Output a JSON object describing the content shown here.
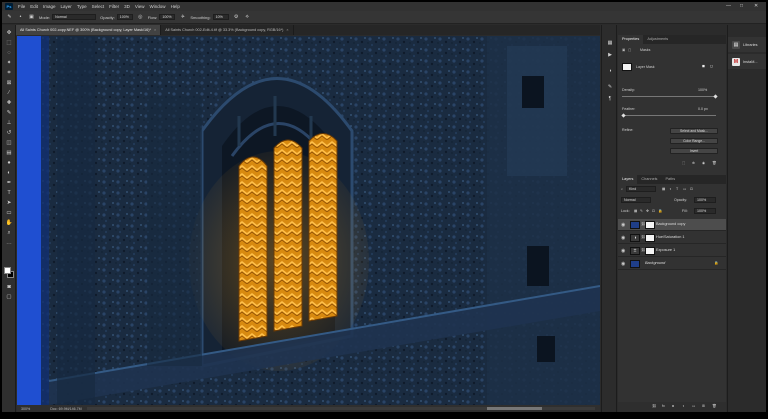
{
  "menu": {
    "logo": "Ps",
    "items": [
      "File",
      "Edit",
      "Image",
      "Layer",
      "Type",
      "Select",
      "Filter",
      "3D",
      "View",
      "Window",
      "Help"
    ],
    "window_controls": [
      "—",
      "□",
      "✕"
    ]
  },
  "options": {
    "mode_label": "Mode:",
    "mode_value": "Normal",
    "opacity_label": "Opacity:",
    "opacity_value": "100%",
    "flow_label": "Flow:",
    "flow_value": "100%",
    "smoothing_label": "Smoothing:",
    "smoothing_value": "10%"
  },
  "tabs": [
    {
      "label": "All Saints Church 002-copy.NEF @ 300% (Background copy, Layer Mask/16)*",
      "close": "×"
    },
    {
      "label": "All Saints Church 002-Edit-4.tif @ 33.3% (Background copy, RGB/16*)",
      "close": "×"
    }
  ],
  "status": {
    "zoom": "300%",
    "doc": "Doc: 69.9M/146.7M"
  },
  "properties": {
    "tab_properties": "Properties",
    "tab_adjustments": "Adjustments",
    "masks_label": "Masks",
    "layer_mask_label": "Layer Mask",
    "density_label": "Density:",
    "density_value": "100%",
    "feather_label": "Feather:",
    "feather_value": "0.0 px",
    "refine_label": "Refine:",
    "select_and_mask": "Select and Mask...",
    "color_range": "Color Range...",
    "invert": "Invert"
  },
  "layers_panel": {
    "tabs": [
      "Layers",
      "Channels",
      "Paths"
    ],
    "kind_label": "Kind",
    "blend_mode": "Normal",
    "opacity_label": "Opacity:",
    "opacity_value": "100%",
    "lock_label": "Lock:",
    "fill_label": "Fill:",
    "fill_value": "100%",
    "layers": [
      {
        "name": "Background copy",
        "selected": true
      },
      {
        "name": "Hue/Saturation 1",
        "selected": false
      },
      {
        "name": "Exposure 1",
        "selected": false
      },
      {
        "name": "Background",
        "selected": false
      }
    ]
  },
  "libraries": {
    "items": [
      {
        "label": "Libraries",
        "icon": "libraries-icon"
      },
      {
        "label": "InstaM...",
        "icon": "plugin-icon"
      }
    ]
  },
  "colors": {
    "window_glow": "#f0a020",
    "canvas_wall": "#1c2d42",
    "accent_blue": "#1f4fd1"
  }
}
